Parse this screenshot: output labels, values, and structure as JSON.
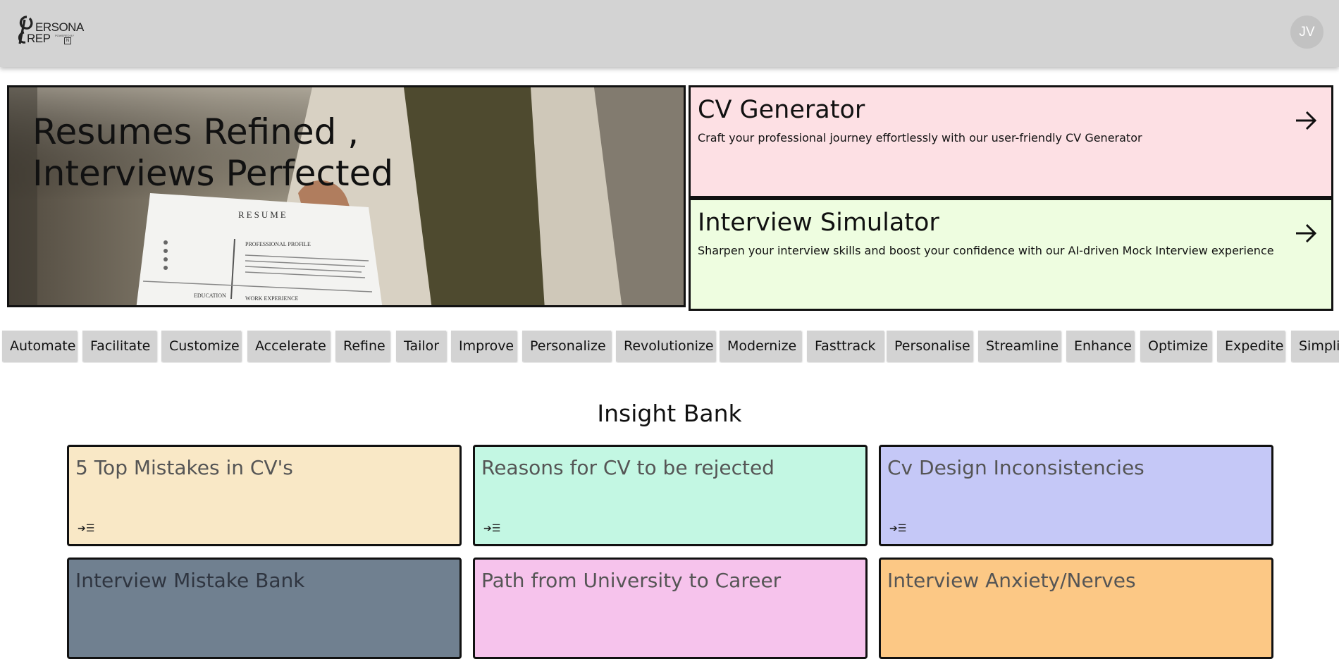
{
  "header": {
    "logo_line1": "ERSONA",
    "logo_line2": "REP",
    "logo_small": "POWERED BY",
    "logo_badge": "N",
    "avatar_initials": "JV"
  },
  "hero": {
    "title_line1": "Resumes Refined ,",
    "title_line2": "Interviews Perfected",
    "paper_heading": "RESUME",
    "paper_section1": "PROFESSIONAL PROFILE",
    "paper_section2": "EDUCATION",
    "paper_section3": "WORK EXPERIENCE"
  },
  "features": [
    {
      "title": "CV Generator",
      "description": "Craft your professional journey effortlessly with our user-friendly CV Generator",
      "color": "#fde0e4"
    },
    {
      "title": "Interview Simulator",
      "description": "Sharpen your interview skills and boost your confidence with our AI-driven Mock Interview experience",
      "color": "#eefde0"
    }
  ],
  "ticker_words": [
    "Automate",
    "Facilitate",
    "Customize",
    "Accelerate",
    "Refine",
    "Tailor",
    "Improve",
    "Personalize",
    "Revolutionize",
    "Modernize",
    "Fasttrack",
    "Personalise",
    "Streamline",
    "Enhance",
    "Optimize",
    "Expedite",
    "Simplify"
  ],
  "insight_bank": {
    "title": "Insight Bank",
    "icon_glyph": "➔☰",
    "items": [
      {
        "title": "5 Top Mistakes in CV's",
        "color": "#f9e8c6"
      },
      {
        "title": "Reasons for CV to be rejected",
        "color": "#c3f7e3"
      },
      {
        "title": "Cv Design Inconsistencies",
        "color": "#c5c8f7"
      },
      {
        "title": "Interview Mistake Bank",
        "color": "#708090"
      },
      {
        "title": "Path from University to Career",
        "color": "#f6c3ec"
      },
      {
        "title": "Interview Anxiety/Nerves",
        "color": "#fcc885"
      }
    ]
  }
}
